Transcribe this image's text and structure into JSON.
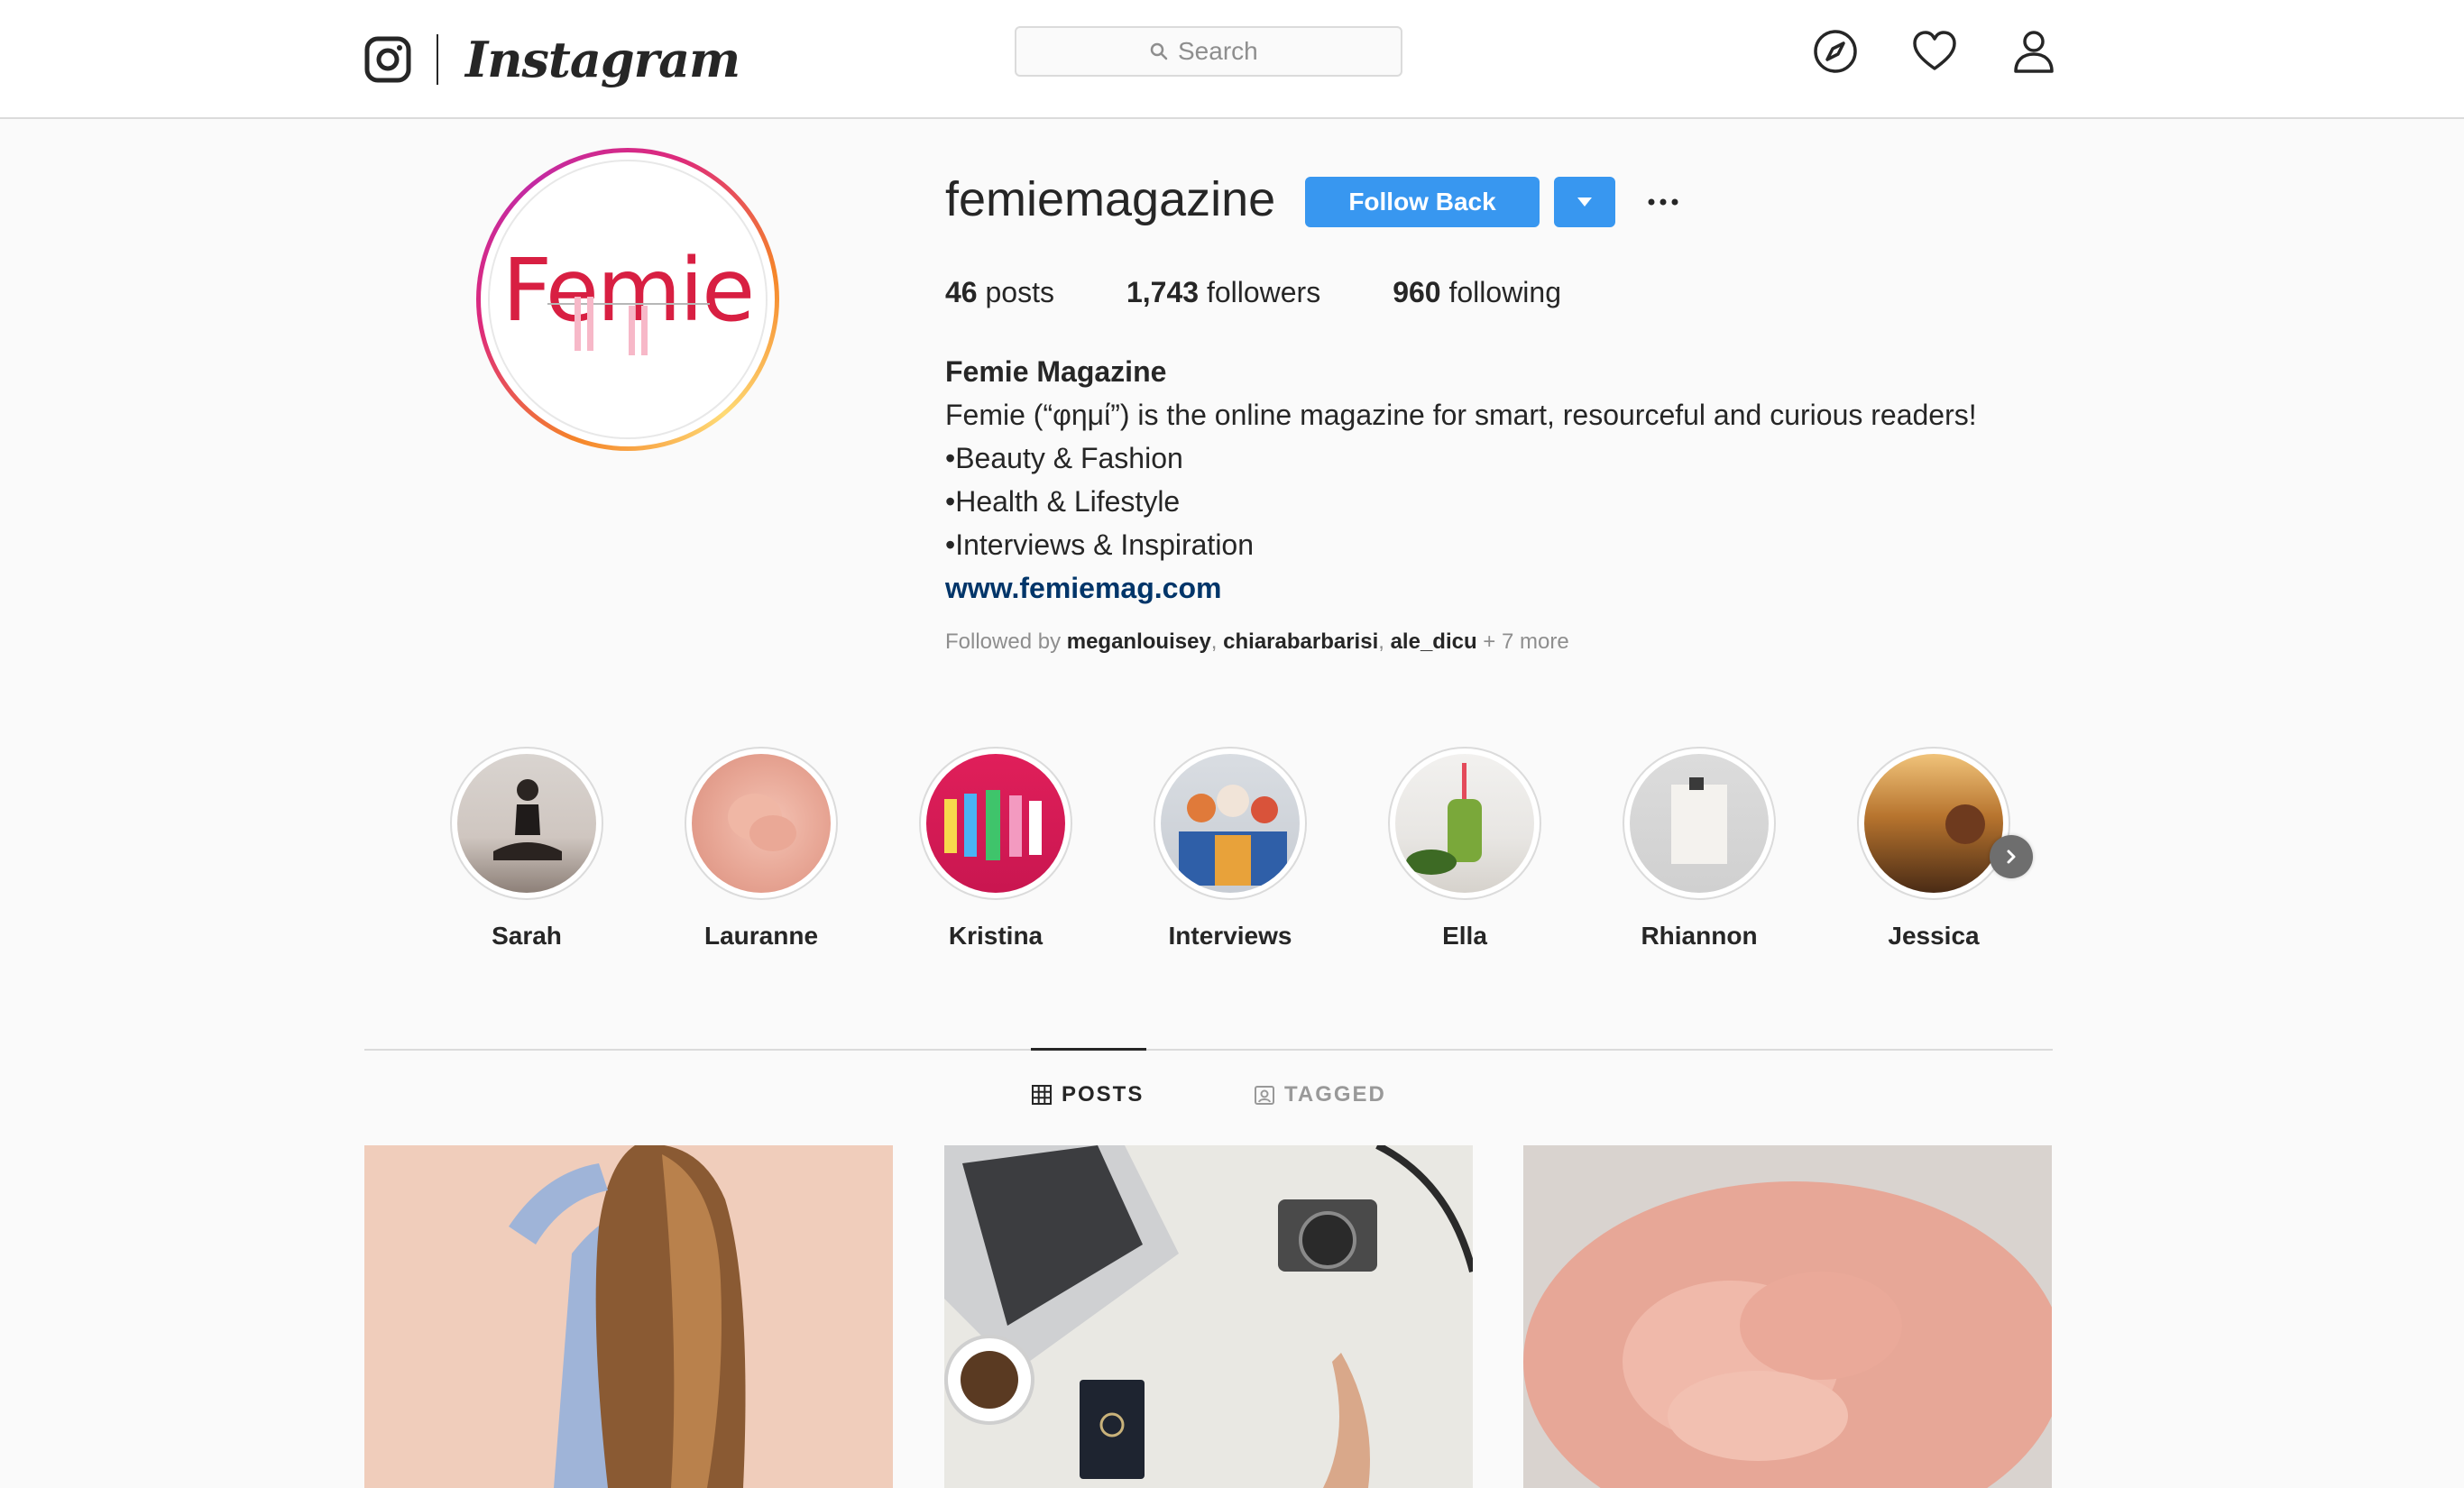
{
  "nav": {
    "brand": "Instagram",
    "search_placeholder": "Search",
    "icons": [
      "explore-icon",
      "activity-heart-icon",
      "profile-icon"
    ]
  },
  "profile": {
    "avatar_text": "Femie",
    "username": "femiemagazine",
    "follow_label": "Follow Back",
    "stats": {
      "posts_count": "46",
      "posts_label": "posts",
      "followers_count": "1,743",
      "followers_label": "followers",
      "following_count": "960",
      "following_label": "following"
    },
    "full_name": "Femie Magazine",
    "bio_lines": [
      "Femie (“φημί”) is the online magazine for smart, resourceful and curious readers!",
      "•Beauty & Fashion",
      "•Health & Lifestyle",
      "•Interviews & Inspiration"
    ],
    "website": "www.femiemag.com",
    "followed_by": {
      "prefix": "Followed by",
      "accounts": [
        "meganlouisey",
        "chiarabarbarisi",
        "ale_dicu"
      ],
      "more": "+ 7 more"
    }
  },
  "highlights": [
    {
      "label": "Sarah"
    },
    {
      "label": "Lauranne"
    },
    {
      "label": "Kristina"
    },
    {
      "label": "Interviews"
    },
    {
      "label": "Ella"
    },
    {
      "label": "Rhiannon"
    },
    {
      "label": "Jessica"
    }
  ],
  "tabs": {
    "posts": "POSTS",
    "tagged": "TAGGED"
  },
  "colors": {
    "accent": "#3897f0",
    "link": "#003569",
    "avatar_text": "#d81f42",
    "border": "#dbdbdb"
  }
}
